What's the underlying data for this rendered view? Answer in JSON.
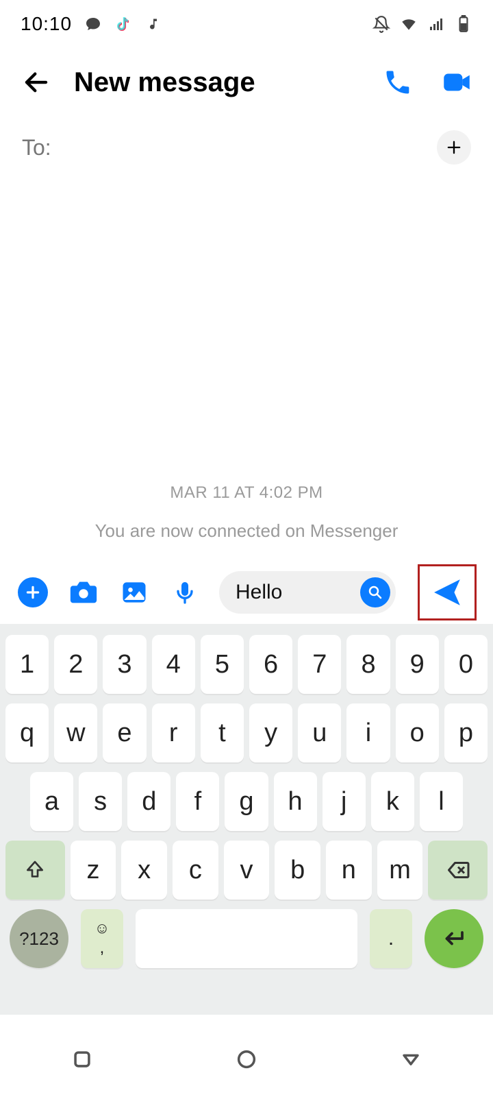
{
  "status": {
    "time": "10:10",
    "icons_left": [
      "chat-bubble",
      "tiktok",
      "music-note"
    ],
    "icons_right": [
      "bell-off",
      "wifi",
      "signal",
      "battery"
    ]
  },
  "header": {
    "title": "New message"
  },
  "to_row": {
    "label": "To:"
  },
  "chat": {
    "timestamp": "MAR 11 AT 4:02 PM",
    "connected_text": "You are now connected on Messenger"
  },
  "composer": {
    "input_value": "Hello"
  },
  "keyboard": {
    "row_numbers": [
      "1",
      "2",
      "3",
      "4",
      "5",
      "6",
      "7",
      "8",
      "9",
      "0"
    ],
    "row_q": [
      "q",
      "w",
      "e",
      "r",
      "t",
      "y",
      "u",
      "i",
      "o",
      "p"
    ],
    "row_a": [
      "a",
      "s",
      "d",
      "f",
      "g",
      "h",
      "j",
      "k",
      "l"
    ],
    "row_z": [
      "z",
      "x",
      "c",
      "v",
      "b",
      "n",
      "m"
    ],
    "fn_label": "?123",
    "emoji_top": "☺",
    "emoji_bottom": ",",
    "period": "."
  }
}
